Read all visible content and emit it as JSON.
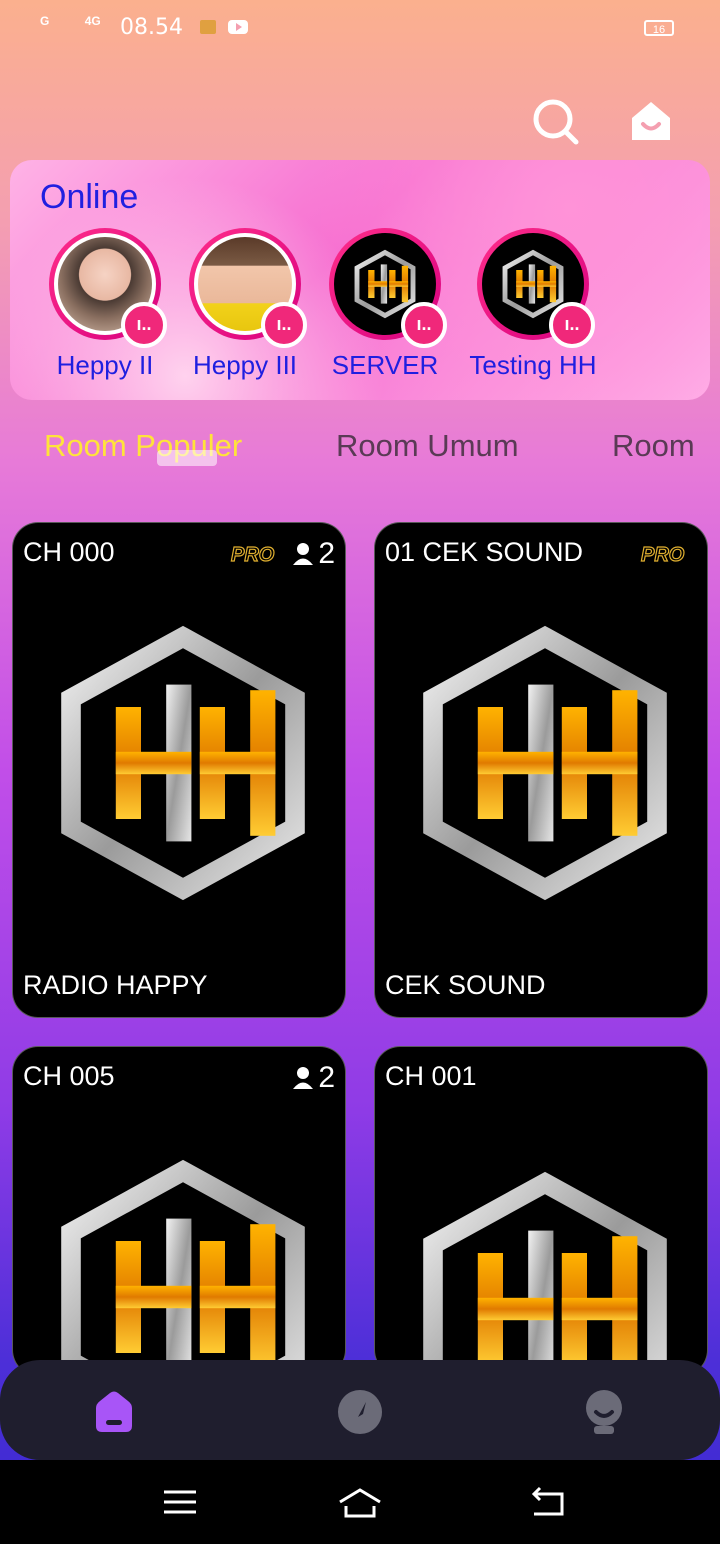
{
  "status_bar": {
    "signal_left": "G",
    "signal_right": "4G",
    "time": "08.54",
    "battery": "16"
  },
  "header": {
    "search_icon": "search-icon",
    "home_icon": "home-smile-icon"
  },
  "online": {
    "title": "Online",
    "users": [
      {
        "name": "Heppy II",
        "avatar": "photo-woman-1"
      },
      {
        "name": "Heppy III",
        "avatar": "photo-woman-2"
      },
      {
        "name": "SERVER",
        "avatar": "hh-logo"
      },
      {
        "name": "Testing HH",
        "avatar": "hh-logo"
      }
    ]
  },
  "tabs": [
    {
      "label": "Room Populer",
      "active": true
    },
    {
      "label": "Room Umum",
      "active": false
    },
    {
      "label": "Room",
      "active": false
    }
  ],
  "rooms": [
    {
      "channel": "CH 000",
      "name": "RADIO HAPPY",
      "pro": true,
      "users": "2"
    },
    {
      "channel": "01 CEK SOUND",
      "name": "CEK SOUND",
      "pro": true,
      "users": ""
    },
    {
      "channel": "CH 005",
      "name": "",
      "pro": false,
      "users": "2"
    },
    {
      "channel": "CH 001",
      "name": "",
      "pro": false,
      "users": ""
    }
  ],
  "bottom_nav": [
    "home-icon",
    "compass-icon",
    "profile-icon"
  ],
  "system_nav": [
    "menu-icon",
    "system-home-icon",
    "back-icon"
  ],
  "colors": {
    "accent_tab": "#ffe33a",
    "online_title": "#2020e0",
    "live_badge": "#f0287a",
    "nav_active": "#a855f7"
  }
}
